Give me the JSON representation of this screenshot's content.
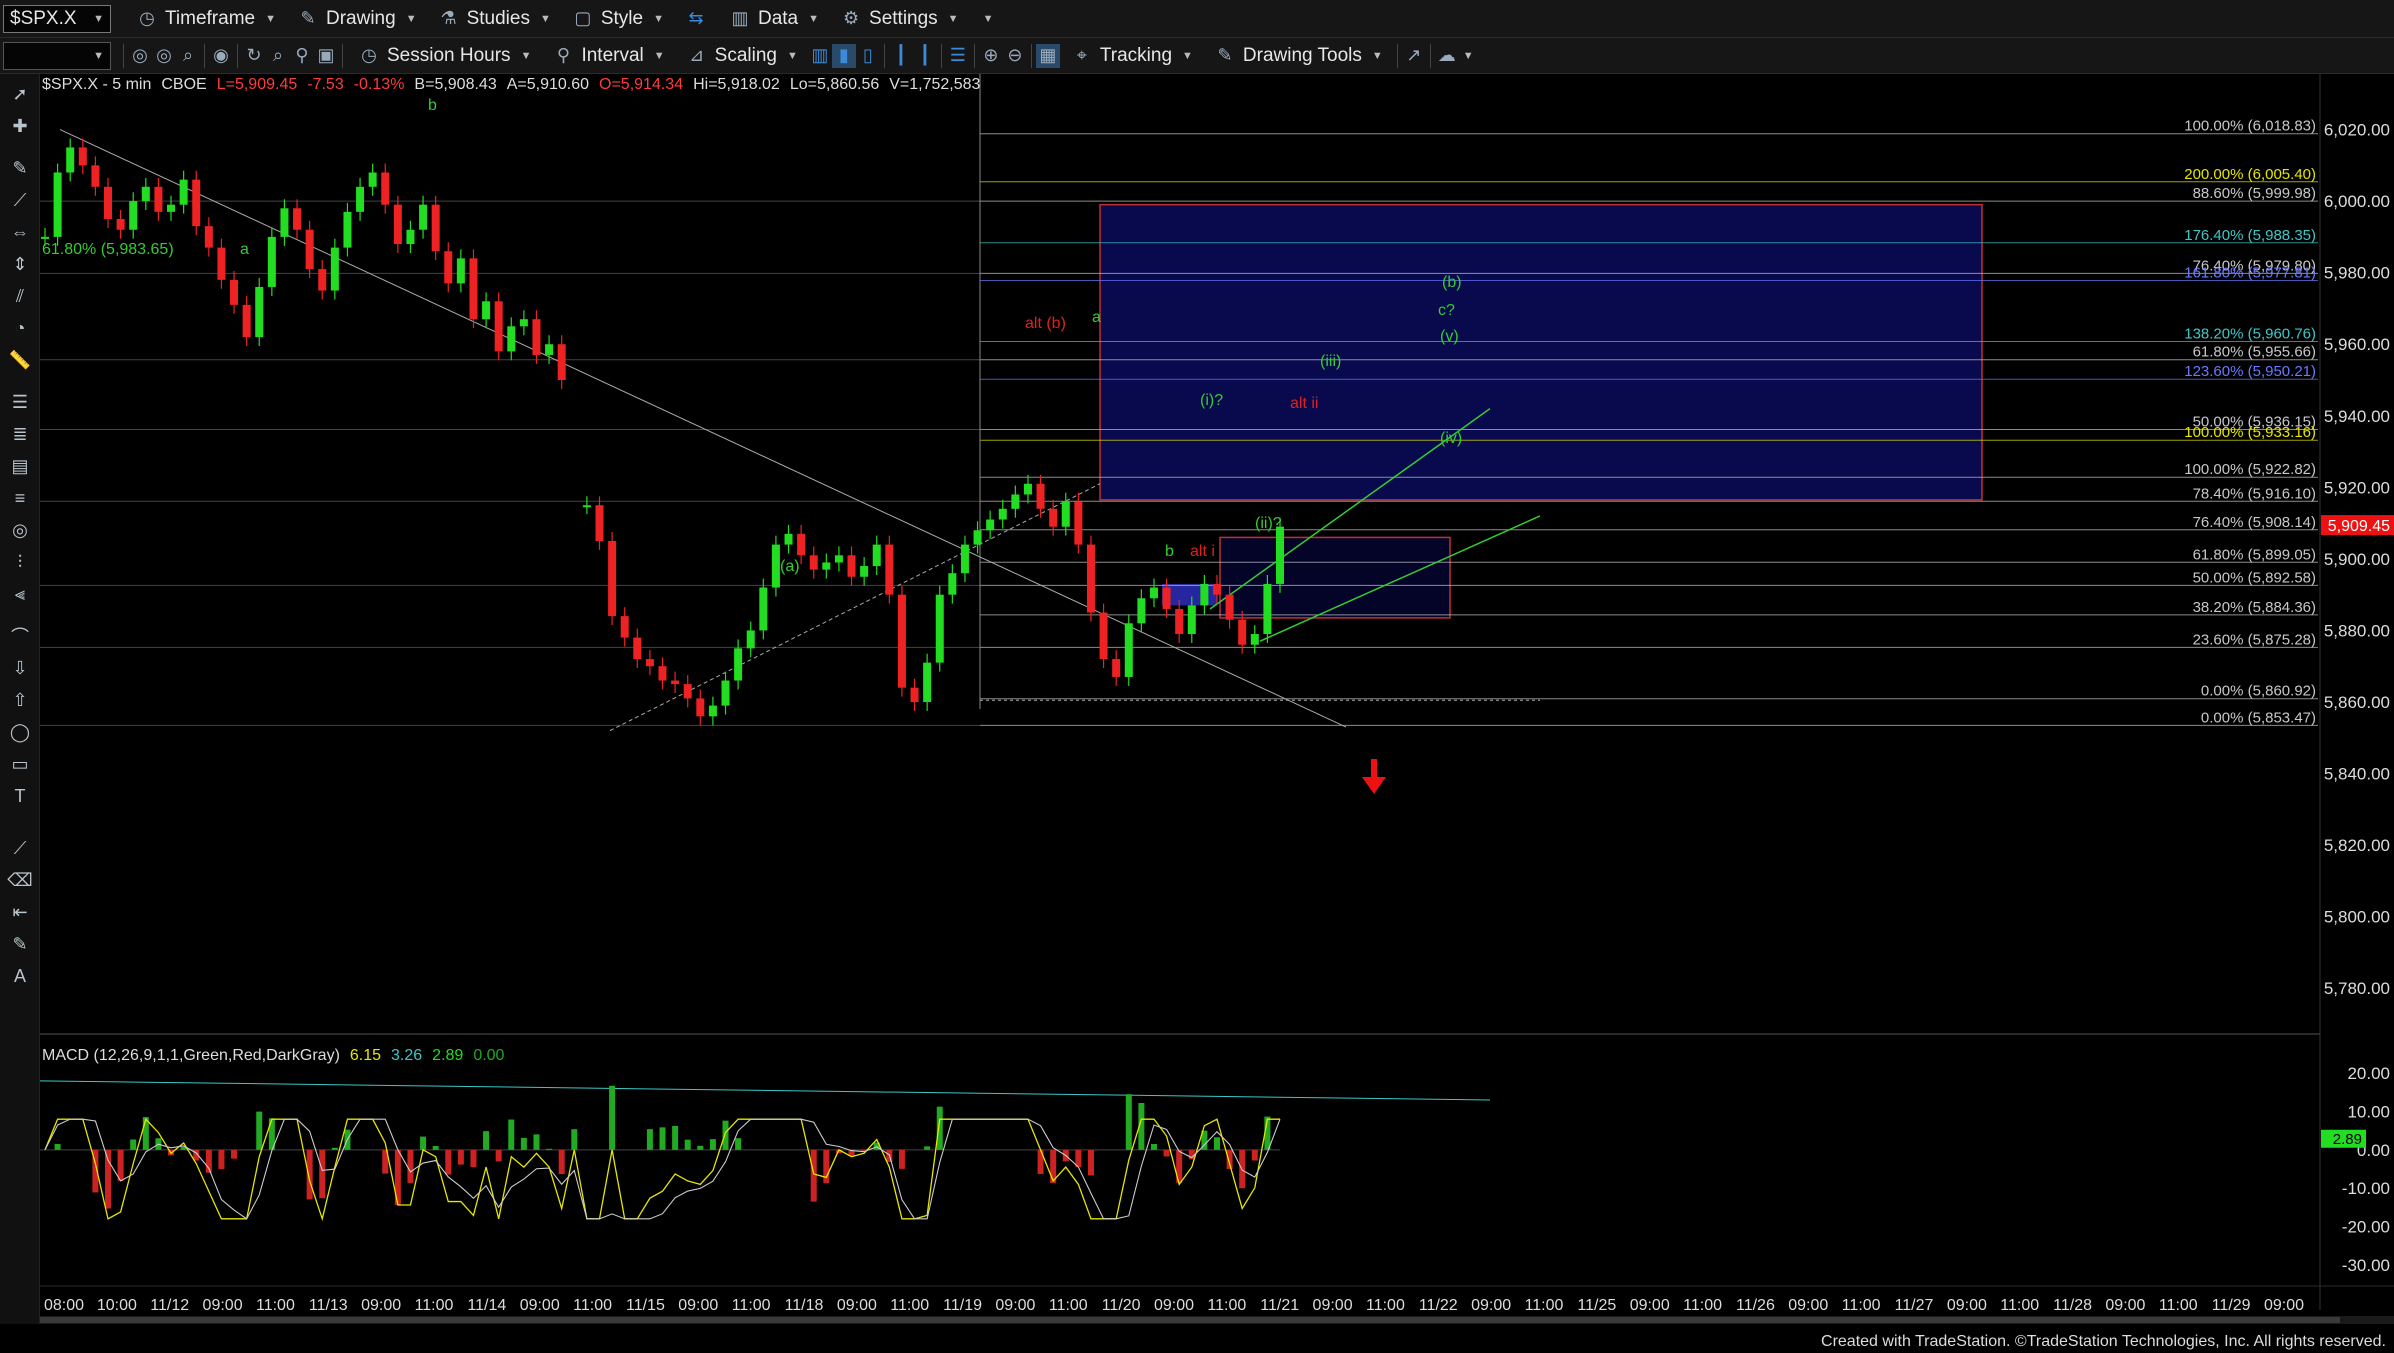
{
  "toolbar": {
    "symbol": "$SPX.X",
    "timeframe": "Timeframe",
    "drawing": "Drawing",
    "studies": "Studies",
    "style": "Style",
    "data": "Data",
    "settings": "Settings",
    "session_hours": "Session Hours",
    "interval": "Interval",
    "scaling": "Scaling",
    "tracking": "Tracking",
    "drawing_tools": "Drawing Tools"
  },
  "quote": {
    "symbol": "$SPX.X - 5 min",
    "exchange": "CBOE",
    "last": "L=5,909.45",
    "change": "-7.53",
    "change_pct": "-0.13%",
    "bid": "B=5,908.43",
    "ask": "A=5,910.60",
    "open": "O=5,914.34",
    "high": "Hi=5,918.02",
    "low": "Lo=5,860.56",
    "volume": "V=1,752,583"
  },
  "macd": {
    "label": "MACD (12,26,9,1,1,Green,Red,DarkGray)",
    "v1": "6.15",
    "v2": "3.26",
    "v3": "2.89",
    "v4": "0.00",
    "current_tag": "2.89"
  },
  "footer": "Created with TradeStation. ©TradeStation Technologies, Inc. All rights reserved.",
  "chart_data": {
    "type": "line",
    "subtype": "candlestick-5min",
    "ylim": [
      5770,
      6040
    ],
    "y_ticks": [
      "6,020.00",
      "6,000.00",
      "5,980.00",
      "5,960.00",
      "5,940.00",
      "5,920.00",
      "5,900.00",
      "5,880.00",
      "5,860.00",
      "5,840.00",
      "5,820.00",
      "5,800.00",
      "5,780.00"
    ],
    "current_price_tag": "5,909.45",
    "x_ticks": [
      "08:00",
      "10:00",
      "11/12",
      "09:00",
      "11:00",
      "11/13",
      "09:00",
      "11:00",
      "11/14",
      "09:00",
      "11:00",
      "11/15",
      "09:00",
      "11:00",
      "11/18",
      "09:00",
      "11:00",
      "11/19",
      "09:00",
      "11:00",
      "11/20",
      "09:00",
      "11:00",
      "11/21",
      "09:00",
      "11:00",
      "11/22",
      "09:00",
      "11:00",
      "11/25",
      "09:00",
      "11:00",
      "11/26",
      "09:00",
      "11:00",
      "11/27",
      "09:00",
      "11:00",
      "11/28",
      "09:00",
      "11:00",
      "11/29",
      "09:00"
    ],
    "price_path": [
      5990,
      6008,
      6015,
      6010,
      6004,
      5995,
      5992,
      6000,
      6004,
      5997,
      5999,
      6006,
      5993,
      5987,
      5978,
      5971,
      5962,
      5976,
      5990,
      5998,
      5992,
      5981,
      5975,
      5987,
      5997,
      6004,
      6008,
      5999,
      5988,
      5992,
      5999,
      5986,
      5977,
      5984,
      5967,
      5972,
      5958,
      5965,
      5967,
      5957,
      5960,
      5950,
      null,
      5915,
      5905,
      5884,
      5878,
      5872,
      5870,
      5866,
      5865,
      5861,
      5856,
      5859,
      5866,
      5875,
      5880,
      5892,
      5904,
      5907,
      5901,
      5897,
      5899,
      5901,
      5895,
      5898,
      5904,
      5890,
      5864,
      5860,
      5871,
      5890,
      5896,
      5904,
      5908,
      5911,
      5914,
      5918,
      5921,
      5914,
      5909,
      5916,
      5904,
      5885,
      5872,
      5867,
      5882,
      5889,
      5892,
      5886,
      5879,
      5887,
      5893,
      5890,
      5883,
      5876,
      5879,
      5893,
      5909
    ],
    "macd_ylim": [
      -35,
      25
    ],
    "macd_y_ticks": [
      "20.00",
      "10.00",
      "0.00",
      "-10.00",
      "-20.00",
      "-30.00"
    ],
    "annotations": [
      {
        "text": "b",
        "color": "#33cc33"
      },
      {
        "text": "a",
        "color": "#33cc33"
      },
      {
        "text": "61.80% (5,983.65)",
        "color": "#33cc33"
      },
      {
        "text": "(a)",
        "color": "#33cc33"
      },
      {
        "text": "alt (b)",
        "color": "#e02020"
      },
      {
        "text": "a",
        "color": "#33cc33"
      },
      {
        "text": "b",
        "color": "#33cc33"
      },
      {
        "text": "alt i",
        "color": "#e02020"
      },
      {
        "text": "(i)?",
        "color": "#33cc33"
      },
      {
        "text": "(ii)?",
        "color": "#33cc33"
      },
      {
        "text": "(iii)",
        "color": "#33cc33"
      },
      {
        "text": "(iv)",
        "color": "#33cc33"
      },
      {
        "text": "(v)",
        "color": "#33cc33"
      },
      {
        "text": "c?",
        "color": "#33cc33"
      },
      {
        "text": "(b)",
        "color": "#33cc33"
      },
      {
        "text": "alt ii",
        "color": "#e02020"
      }
    ],
    "fib_levels": [
      {
        "label": "100.00% (6,018.83)",
        "value": 6018.83,
        "color": "#c8c8c8"
      },
      {
        "label": "200.00% (6,005.40)",
        "value": 6005.4,
        "color": "#e6e600"
      },
      {
        "label": "88.60% (5,999.98)",
        "value": 5999.98,
        "color": "#c8c8c8"
      },
      {
        "label": "176.40% (5,988.35)",
        "value": 5988.35,
        "color": "#3cc8c8"
      },
      {
        "label": "76.40% (5,979.80)",
        "value": 5979.8,
        "color": "#c8c8c8"
      },
      {
        "label": "161.80% (5,977.81)",
        "value": 5977.81,
        "color": "#6a7aff"
      },
      {
        "label": "138.20% (5,960.76)",
        "value": 5960.76,
        "color": "#3cc8c8"
      },
      {
        "label": "61.80% (5,955.66)",
        "value": 5955.66,
        "color": "#c8c8c8"
      },
      {
        "label": "123.60% (5,950.21)",
        "value": 5950.21,
        "color": "#6a7aff"
      },
      {
        "label": "50.00% (5,936.15)",
        "value": 5936.15,
        "color": "#c8c8c8"
      },
      {
        "label": "100.00% (5,933.16)",
        "value": 5933.16,
        "color": "#e6e600"
      },
      {
        "label": "100.00% (5,922.82)",
        "value": 5922.82,
        "color": "#c8c8c8"
      },
      {
        "label": "78.40% (5,916.10)",
        "value": 5916.1,
        "color": "#c8c8c8"
      },
      {
        "label": "76.40% (5,908.14)",
        "value": 5908.14,
        "color": "#c8c8c8"
      },
      {
        "label": "61.80% (5,899.05)",
        "value": 5899.05,
        "color": "#c8c8c8"
      },
      {
        "label": "50.00% (5,892.58)",
        "value": 5892.58,
        "color": "#c8c8c8"
      },
      {
        "label": "38.20% (5,884.36)",
        "value": 5884.36,
        "color": "#c8c8c8"
      },
      {
        "label": "23.60% (5,875.28)",
        "value": 5875.28,
        "color": "#c8c8c8"
      },
      {
        "label": "0.00% (5,860.92)",
        "value": 5860.92,
        "color": "#c8c8c8"
      },
      {
        "label": "0.00% (5,853.47)",
        "value": 5853.47,
        "color": "#c8c8c8"
      }
    ]
  }
}
